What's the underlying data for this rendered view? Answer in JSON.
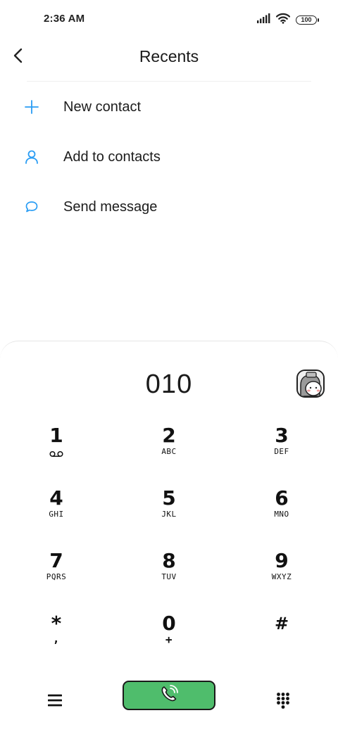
{
  "status_bar": {
    "time": "2:36 AM",
    "battery": "100",
    "icons": [
      "signal-icon",
      "wifi-icon",
      "battery-icon"
    ]
  },
  "header": {
    "title": "Recents",
    "back_icon": "back-arrow-icon"
  },
  "actions": [
    {
      "label": "New contact",
      "icon": "plus-icon"
    },
    {
      "label": "Add to contacts",
      "icon": "person-icon"
    },
    {
      "label": "Send message",
      "icon": "message-bubble-icon"
    }
  ],
  "dialer": {
    "number": "010",
    "keys": [
      {
        "digit": "1",
        "letters": "voicemail"
      },
      {
        "digit": "2",
        "letters": "ABC"
      },
      {
        "digit": "3",
        "letters": "DEF"
      },
      {
        "digit": "4",
        "letters": "GHI"
      },
      {
        "digit": "5",
        "letters": "JKL"
      },
      {
        "digit": "6",
        "letters": "MNO"
      },
      {
        "digit": "7",
        "letters": "PQRS"
      },
      {
        "digit": "8",
        "letters": "TUV"
      },
      {
        "digit": "9",
        "letters": "WXYZ"
      },
      {
        "digit": "*",
        "letters": ","
      },
      {
        "digit": "0",
        "letters": "+"
      },
      {
        "digit": "#",
        "letters": ""
      }
    ],
    "bottom": {
      "menu_icon": "menu-icon",
      "call_icon": "phone-call-icon",
      "keypad_icon": "keypad-icon"
    }
  },
  "colors": {
    "accent_blue": "#2a9df4",
    "call_green": "#4fbd6c"
  }
}
